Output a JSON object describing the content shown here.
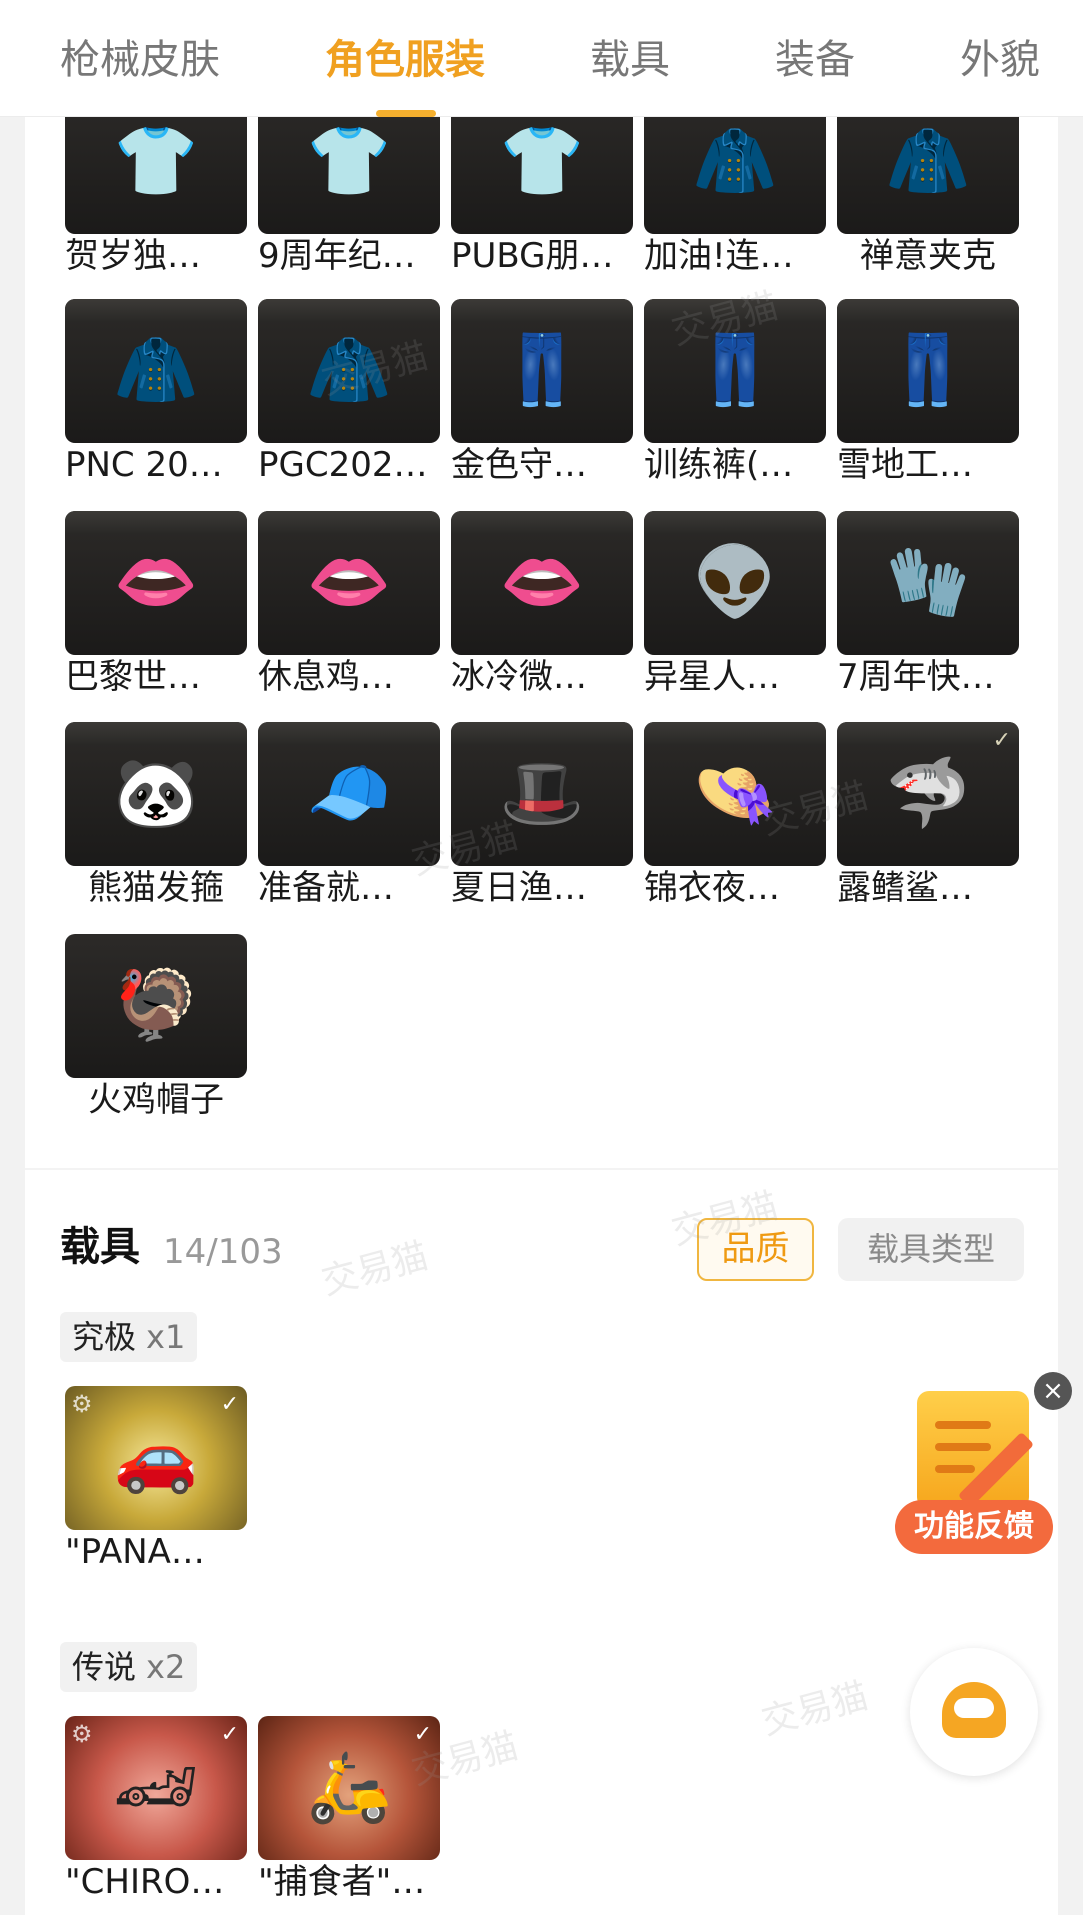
{
  "tabs": [
    {
      "label": "枪械皮肤",
      "active": false
    },
    {
      "label": "角色服装",
      "active": true
    },
    {
      "label": "载具",
      "active": false
    },
    {
      "label": "装备",
      "active": false
    },
    {
      "label": "外貌",
      "active": false
    }
  ],
  "outfits": {
    "row1": [
      "贺岁独…",
      "9周年纪…",
      "PUBG朋…",
      "加油!连…",
      "禅意夹克"
    ],
    "row2": [
      "PNC 20…",
      "PGC202…",
      "金色守…",
      "训练裤(…",
      "雪地工…"
    ],
    "row3": [
      "巴黎世…",
      "休息鸡…",
      "冰冷微…",
      "异星人…",
      "7周年快…"
    ],
    "row4": [
      "熊猫发箍",
      "准备就…",
      "夏日渔…",
      "锦衣夜…",
      "露鳍鲨…"
    ],
    "row5": [
      "火鸡帽子"
    ]
  },
  "vehicles": {
    "title": "载具",
    "count": "14/103",
    "filter_quality": "品质",
    "filter_type": "载具类型",
    "groups": [
      {
        "rarity": "究极",
        "mult": "x1",
        "items": [
          "\"PANA…"
        ]
      },
      {
        "rarity": "传说",
        "mult": "x2",
        "items": [
          "\"CHIRO…",
          "\"捕食者\"…"
        ]
      }
    ]
  },
  "feedback_label": "功能反馈",
  "close_glyph": "×",
  "check_glyph": "✓",
  "watermark": "交易猫",
  "colors": {
    "accent": "#f0a020",
    "feedback": "#f36a3d"
  }
}
